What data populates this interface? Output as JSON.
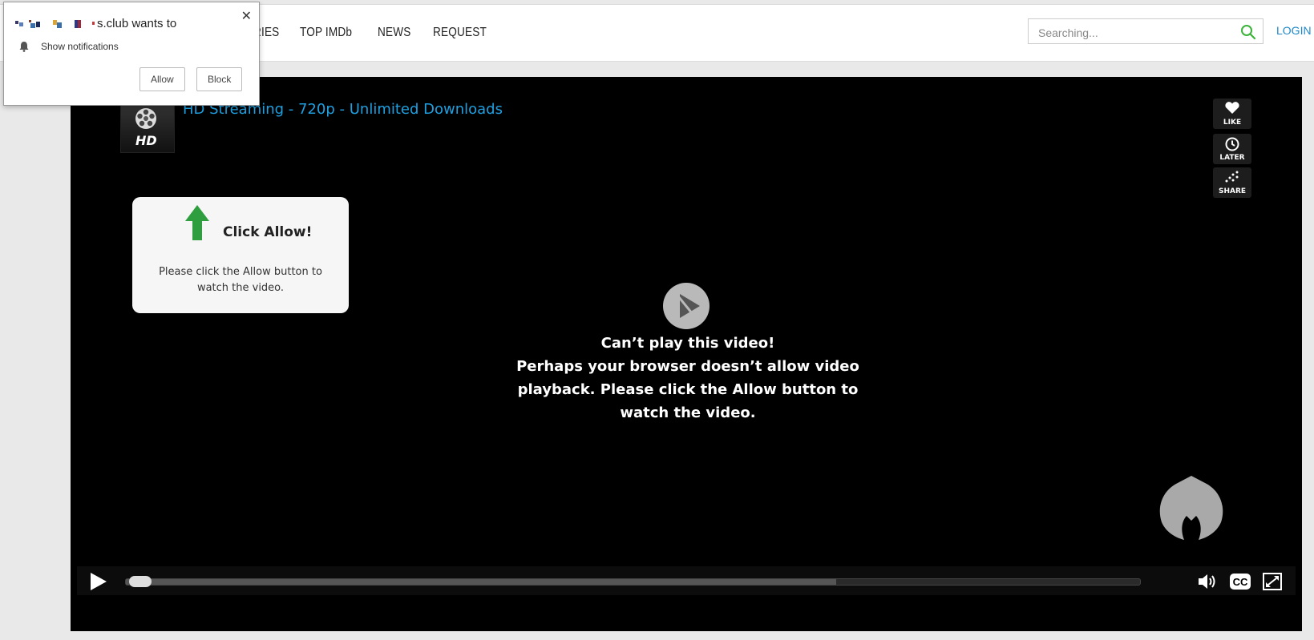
{
  "header": {
    "nav": [
      "RIES",
      "TOP IMDb",
      "NEWS",
      "REQUEST"
    ],
    "search_placeholder": "Searching...",
    "login_label": "LOGIN"
  },
  "player": {
    "title": "HD Streaming - 720p - Unlimited Downloads",
    "logo_text": "HD",
    "side_buttons": [
      "LIKE",
      "LATER",
      "SHARE"
    ],
    "allow_box": {
      "heading": "Click Allow!",
      "message": "Please click the Allow button to watch the video."
    },
    "error": {
      "line1": "Can’t play this video!",
      "line2": "Perhaps your browser doesn’t allow video playback. Please click the Allow button to watch the video."
    },
    "buffered_fraction": 0.7,
    "icons": [
      "play-icon",
      "volume-icon",
      "cc-icon",
      "fullscreen-icon"
    ]
  },
  "popup": {
    "site_suffix": "s.club wants to",
    "permission": "Show notifications",
    "allow_label": "Allow",
    "block_label": "Block",
    "close_glyph": "✕"
  },
  "colors": {
    "accent": "#1ea0e0",
    "login": "#1e88c8",
    "arrow": "#2e9e3e",
    "search_icon": "#3bb33b"
  }
}
